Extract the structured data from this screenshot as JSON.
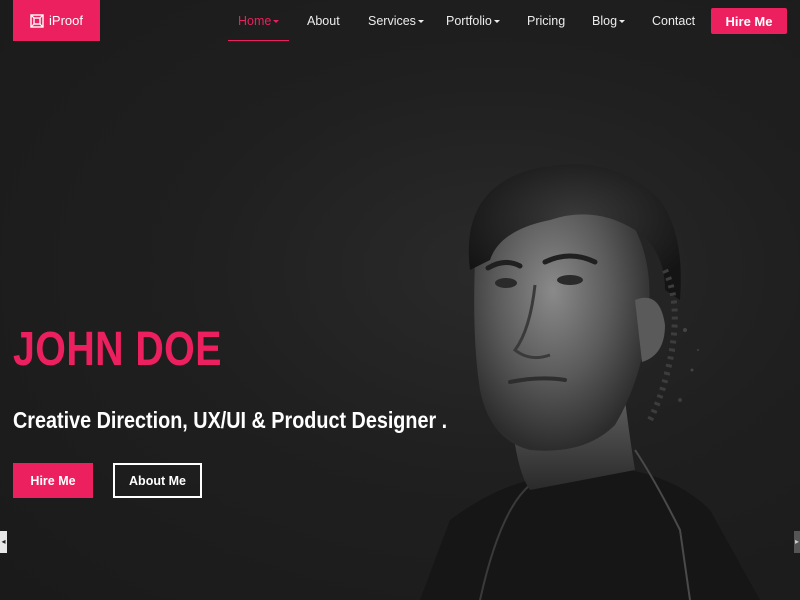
{
  "brand": {
    "name": "iProof",
    "icon": "logo-mark-icon",
    "color": "#ec1f5f"
  },
  "nav": {
    "items": [
      {
        "label": "Home",
        "dropdown": true,
        "active": true
      },
      {
        "label": "About",
        "dropdown": false,
        "active": false
      },
      {
        "label": "Services",
        "dropdown": true,
        "active": false
      },
      {
        "label": "Portfolio",
        "dropdown": true,
        "active": false
      },
      {
        "label": "Pricing",
        "dropdown": false,
        "active": false
      },
      {
        "label": "Blog",
        "dropdown": true,
        "active": false
      },
      {
        "label": "Contact",
        "dropdown": false,
        "active": false
      }
    ],
    "cta_label": "Hire Me"
  },
  "hero": {
    "name": "JOHN DOE",
    "subtitle": "Creative Direction, UX/UI & Product Designer .",
    "primary_button": "Hire Me",
    "secondary_button": "About Me"
  },
  "slider": {
    "prev_icon": "chevron-left-icon",
    "next_icon": "chevron-right-icon"
  },
  "colors": {
    "accent": "#ec1f5f",
    "background": "#1e1e1e",
    "text": "#ffffff"
  }
}
